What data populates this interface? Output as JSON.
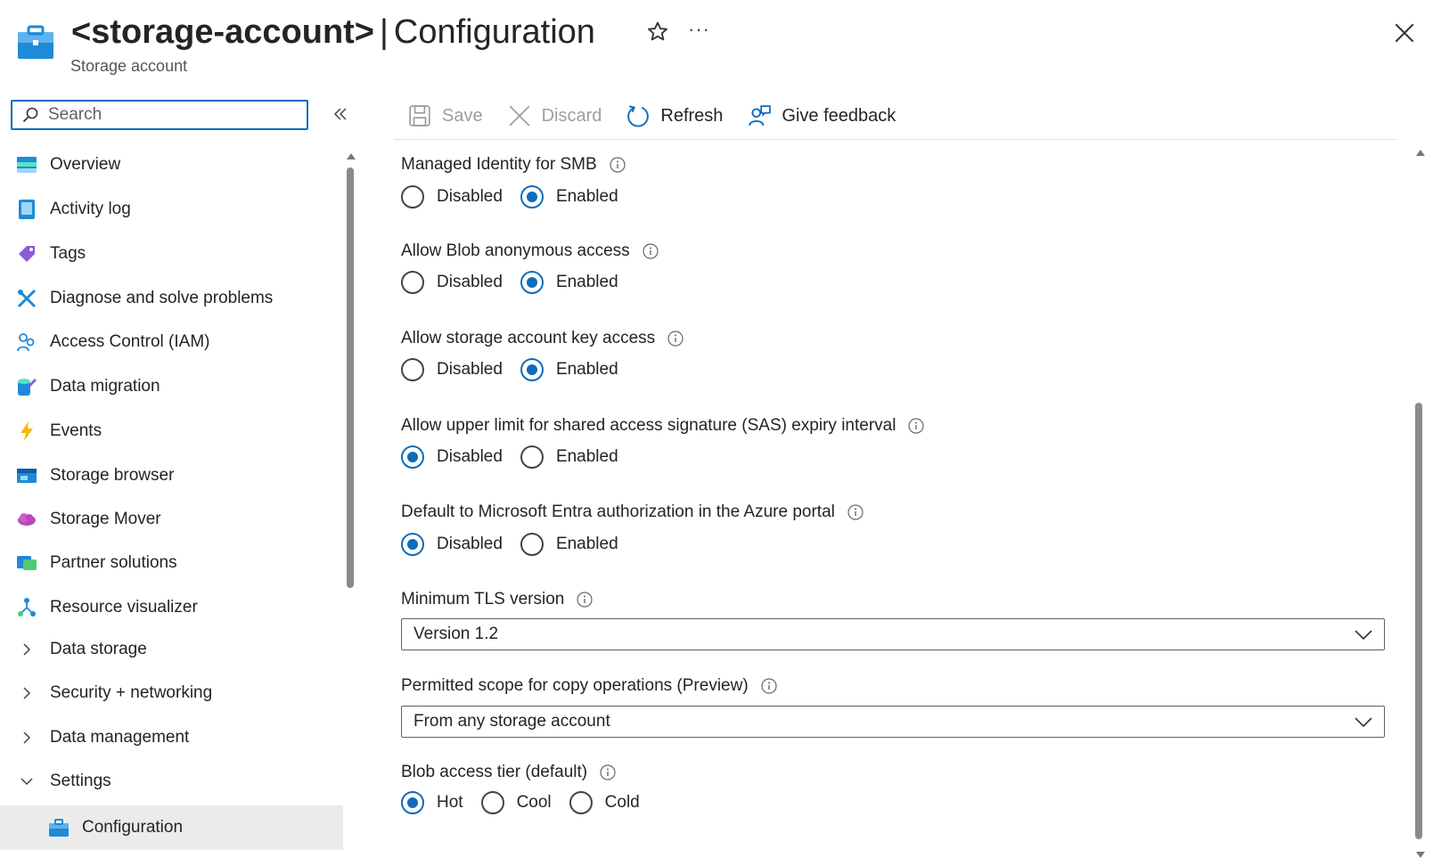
{
  "header": {
    "title_bold": "<storage-account>",
    "title_separator": "|",
    "title_rest": "Configuration",
    "subtitle": "Storage account",
    "more_label": "···"
  },
  "sidebar": {
    "search_placeholder": "Search",
    "items": [
      {
        "label": "Overview",
        "icon": "overview-icon"
      },
      {
        "label": "Activity log",
        "icon": "activity-log-icon"
      },
      {
        "label": "Tags",
        "icon": "tag-icon"
      },
      {
        "label": "Diagnose and solve problems",
        "icon": "wrench-icon"
      },
      {
        "label": "Access Control (IAM)",
        "icon": "people-icon"
      },
      {
        "label": "Data migration",
        "icon": "data-migration-icon"
      },
      {
        "label": "Events",
        "icon": "lightning-icon"
      },
      {
        "label": "Storage browser",
        "icon": "storage-browser-icon"
      },
      {
        "label": "Storage Mover",
        "icon": "cloud-mover-icon"
      },
      {
        "label": "Partner solutions",
        "icon": "partner-icon"
      },
      {
        "label": "Resource visualizer",
        "icon": "visualizer-icon"
      },
      {
        "label": "Data storage",
        "icon": "chevron-right-icon"
      },
      {
        "label": "Security + networking",
        "icon": "chevron-right-icon"
      },
      {
        "label": "Data management",
        "icon": "chevron-right-icon"
      },
      {
        "label": "Settings",
        "icon": "chevron-down-icon"
      },
      {
        "label": "Configuration",
        "icon": "configuration-icon",
        "active": true
      }
    ]
  },
  "toolbar": {
    "save": "Save",
    "discard": "Discard",
    "refresh": "Refresh",
    "feedback": "Give feedback"
  },
  "settings": {
    "smb": {
      "label": "Managed Identity for SMB",
      "options": [
        "Disabled",
        "Enabled"
      ],
      "selected": "Enabled"
    },
    "blob_anon": {
      "label": "Allow Blob anonymous access",
      "options": [
        "Disabled",
        "Enabled"
      ],
      "selected": "Enabled"
    },
    "key_access": {
      "label": "Allow storage account key access",
      "options": [
        "Disabled",
        "Enabled"
      ],
      "selected": "Enabled"
    },
    "sas_expiry": {
      "label": "Allow upper limit for shared access signature (SAS) expiry interval",
      "options": [
        "Disabled",
        "Enabled"
      ],
      "selected": "Disabled"
    },
    "entra_default": {
      "label": "Default to Microsoft Entra authorization in the Azure portal",
      "options": [
        "Disabled",
        "Enabled"
      ],
      "selected": "Disabled"
    },
    "tls": {
      "label": "Minimum TLS version",
      "value": "Version 1.2"
    },
    "copy_scope": {
      "label": "Permitted scope for copy operations (Preview)",
      "value": "From any storage account"
    },
    "access_tier": {
      "label": "Blob access tier (default)",
      "options": [
        "Hot",
        "Cool",
        "Cold"
      ],
      "selected": "Hot"
    }
  },
  "colors": {
    "accent": "#0f6cbd",
    "active_nav_bg": "#ebebeb",
    "disabled_text": "#9e9e9e"
  }
}
